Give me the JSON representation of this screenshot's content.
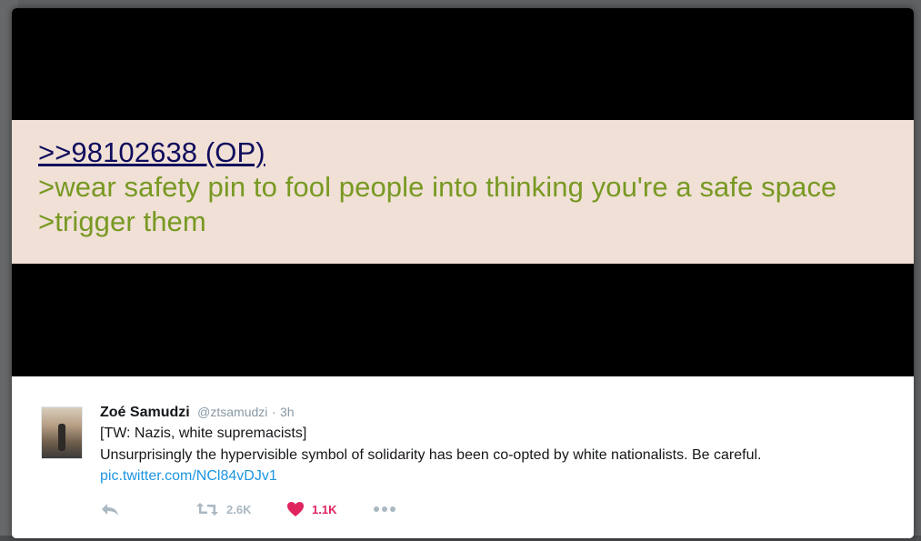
{
  "greentext": {
    "post_link": ">>98102638 (OP)",
    "line1": ">wear safety pin to fool people into thinking you're a safe space",
    "line2": ">trigger them"
  },
  "tweet": {
    "name": "Zoé Samudzi",
    "handle": "@ztsamudzi",
    "separator": "·",
    "time": "3h",
    "text_line1": "[TW: Nazis, white supremacists]",
    "text_line2": "Unsurprisingly the hypervisible symbol of solidarity has been co-opted by white nationalists. Be careful.",
    "link": "pic.twitter.com/NCl84vDJv1"
  },
  "actions": {
    "reply_icon": "reply-icon",
    "retweet_icon": "retweet-icon",
    "retweet_count": "2.6K",
    "like_icon": "heart-icon",
    "like_count": "1.1K",
    "more_icon": "more-icon"
  },
  "colors": {
    "greentext": "#789922",
    "post_link": "#0f0c5d",
    "panel_bg": "#f0e0d6",
    "like": "#e0245e",
    "link": "#1b95e0",
    "muted": "#aab8c2"
  }
}
